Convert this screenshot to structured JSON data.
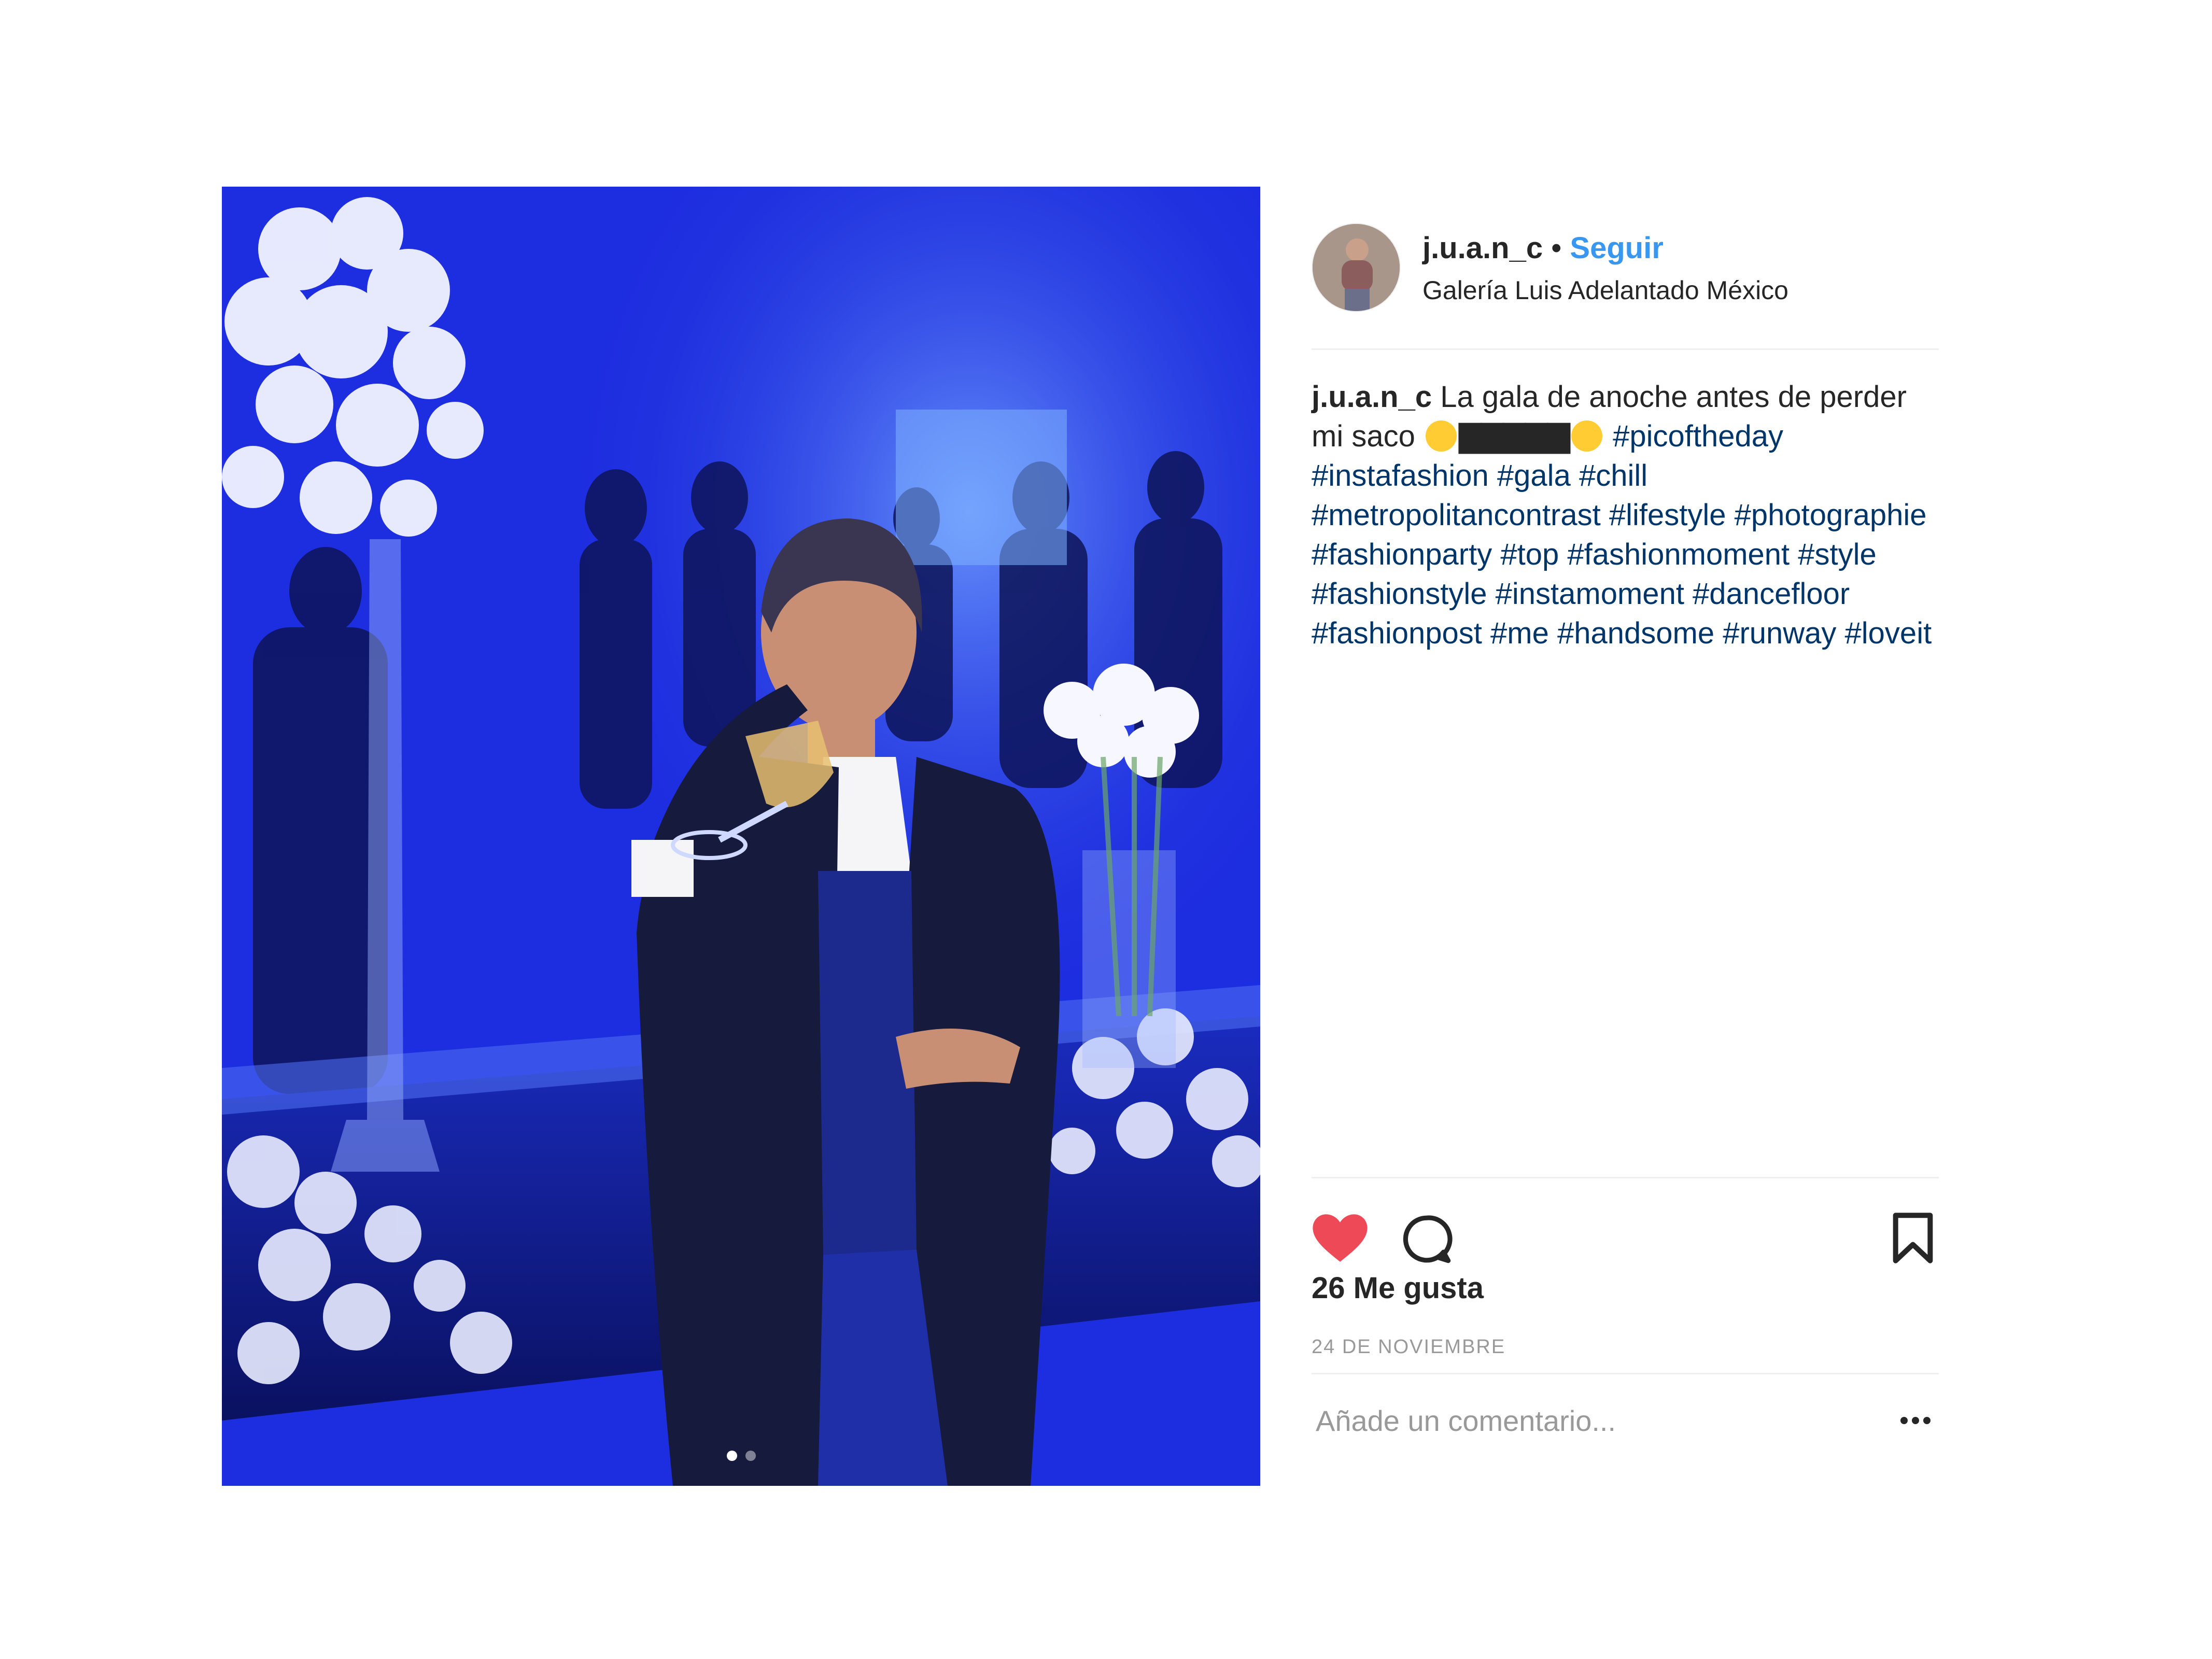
{
  "post": {
    "username": "j.u.a.n_c",
    "separator": "•",
    "follow_label": "Seguir",
    "location": "Galería Luis Adelantado México",
    "caption": {
      "username": "j.u.a.n_c",
      "text": "La gala de anoche antes de perder mi saco",
      "blocks": "▇▇▇▇▇",
      "hashtags": "#picoftheday #instafashion #gala #chill #metropolitancontrast #lifestyle #photographie #fashionparty #top #fashionmoment #style #fashionstyle #instamoment #dancefloor #fashionpost #me #handsome #runway #loveit"
    },
    "likes": "26 Me gusta",
    "date": "24 DE NOVIEMBRE",
    "comment_placeholder": "Añade un comentario...",
    "carousel": {
      "count": 2,
      "active": 1
    }
  },
  "icons": {
    "like": "heart-icon",
    "comment": "comment-icon",
    "save": "bookmark-icon",
    "more": "more-options-icon"
  },
  "colors": {
    "accent": "#3897f0",
    "hashtag": "#003569",
    "like": "#ed4956",
    "text": "#262626",
    "muted": "#999999",
    "divider": "#efefef"
  }
}
